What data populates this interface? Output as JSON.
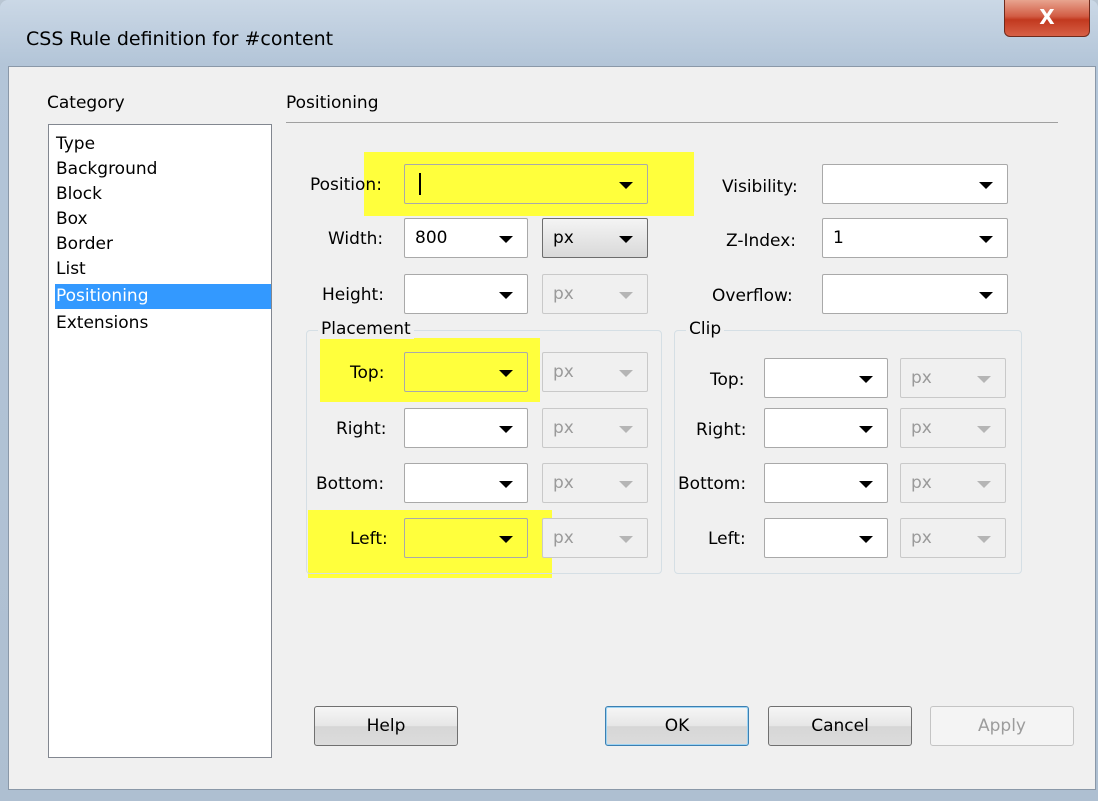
{
  "window": {
    "title": "CSS Rule definition for #content",
    "close_label": "X"
  },
  "category": {
    "header": "Category",
    "items": [
      "Type",
      "Background",
      "Block",
      "Box",
      "Border",
      "List",
      "Positioning",
      "Extensions"
    ],
    "selected": "Positioning"
  },
  "section": {
    "title": "Positioning"
  },
  "fields": {
    "position": {
      "label": "Position:",
      "value": ""
    },
    "width": {
      "label": "Width:",
      "value": "800",
      "unit": "px"
    },
    "height": {
      "label": "Height:",
      "value": "",
      "unit": "px"
    },
    "visibility": {
      "label": "Visibility:",
      "value": ""
    },
    "zindex": {
      "label": "Z-Index:",
      "value": "1"
    },
    "overflow": {
      "label": "Overflow:",
      "value": ""
    }
  },
  "placement": {
    "title": "Placement",
    "top": {
      "label": "Top:",
      "unit": "px"
    },
    "right": {
      "label": "Right:",
      "unit": "px"
    },
    "bottom": {
      "label": "Bottom:",
      "unit": "px"
    },
    "left": {
      "label": "Left:",
      "unit": "px"
    }
  },
  "clip": {
    "title": "Clip",
    "top": {
      "label": "Top:",
      "unit": "px"
    },
    "right": {
      "label": "Right:",
      "unit": "px"
    },
    "bottom": {
      "label": "Bottom:",
      "unit": "px"
    },
    "left": {
      "label": "Left:",
      "unit": "px"
    }
  },
  "buttons": {
    "help": "Help",
    "ok": "OK",
    "cancel": "Cancel",
    "apply": "Apply"
  },
  "colors": {
    "highlight": "#ffff3c",
    "selection": "#3399ff"
  }
}
